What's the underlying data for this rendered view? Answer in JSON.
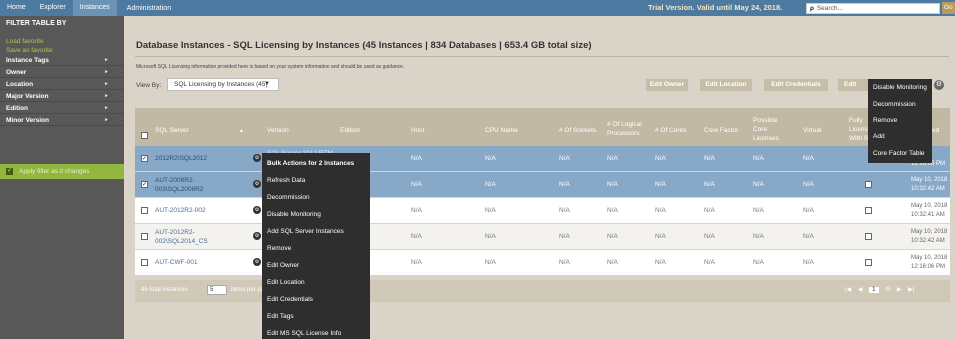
{
  "topbar": {
    "tabs": [
      "Home",
      "Explorer",
      "Instances"
    ],
    "admin": "Administration",
    "trial": "Trial Version. Valid until May 24, 2018.",
    "search_placeholder": "Search...",
    "go": "Go"
  },
  "sidebar": {
    "title": "FILTER TABLE BY",
    "load_favorite": "Load favorite",
    "save_favorite": "Save as favorite",
    "items": [
      "Instance Tags",
      "Owner",
      "Location",
      "Major Version",
      "Edition",
      "Minor Version"
    ],
    "apply": "Apply filter as it changes"
  },
  "main": {
    "title": "Database Instances - SQL Licensing by Instances (45 Instances | 834 Databases | 653.4 GB total size)",
    "guidance": "Microsoft SQL Licensing information provided here is based on your system information and should be used as guidance.",
    "view_by_label": "View By:",
    "view_by_value": "SQL Licensing by Instances (45)",
    "buttons": {
      "edit_owner": "Edit Owner",
      "edit_location": "Edit Location",
      "edit_credentials": "Edit Credentials",
      "edit_tags": "Edit Tags"
    }
  },
  "table": {
    "headers": {
      "sql_server": "SQL Server",
      "version": "Version",
      "edition": "Edition",
      "host": "Host",
      "cpu_name": "CPU Name",
      "sockets": "# Of Sockets",
      "logical_l1": "# Of Logical",
      "logical_l2": "Processors",
      "cores": "# Of Cores",
      "core_factor": "Core Factor",
      "possible_l1": "Possible",
      "possible_l2": "Core",
      "possible_l3": "Licenses",
      "virtual": "Virtual",
      "fully_l1": "Fully",
      "fully_l2": "Licens",
      "fully_l3": "With S",
      "last": "ed"
    },
    "rows": [
      {
        "server_l1": "2012R2\\SQL2012",
        "server_l2": "",
        "version": "SQL Server 2012 RTM",
        "na": "N/A",
        "date_l1": "",
        "date_l2": "12:16:06 PM"
      },
      {
        "server_l1": "AUT-2008R2-",
        "server_l2": "003\\SQL2008R2",
        "version": "",
        "na": "N/A",
        "date_l1": "May 10, 2018",
        "date_l2": "10:32:42 AM"
      },
      {
        "server_l1": "AUT-2012R2-002",
        "server_l2": "",
        "version": "",
        "na": "N/A",
        "date_l1": "May 10, 2018",
        "date_l2": "10:32:41 AM"
      },
      {
        "server_l1": "AUT-2012R2-",
        "server_l2": "002\\SQL2014_CS",
        "version": "",
        "na": "N/A",
        "date_l1": "May 10, 2018",
        "date_l2": "10:32:42 AM"
      },
      {
        "server_l1": "AUT-CWF-001",
        "server_l2": "",
        "version": "",
        "na": "N/A",
        "date_l1": "May 10, 2018",
        "date_l2": "12:16:06 PM"
      }
    ],
    "footer": {
      "total": "45 total instances",
      "per_page_value": "5",
      "per_page_label": "items per page",
      "page": "1",
      "of_pages": "/9"
    }
  },
  "bulk_menu": {
    "header": "Bulk Actions for 2 Instances",
    "items": [
      "Refresh Data",
      "Decommission",
      "Disable Monitoring",
      "Add SQL Server Instances",
      "Remove",
      "Edit Owner",
      "Edit Location",
      "Edit Credentials",
      "Edit Tags",
      "Edit MS SQL License Info"
    ]
  },
  "right_menu": {
    "items": [
      "Disable Monitoring",
      "Decommission",
      "Remove",
      "Add",
      "Core Factor Table"
    ]
  }
}
